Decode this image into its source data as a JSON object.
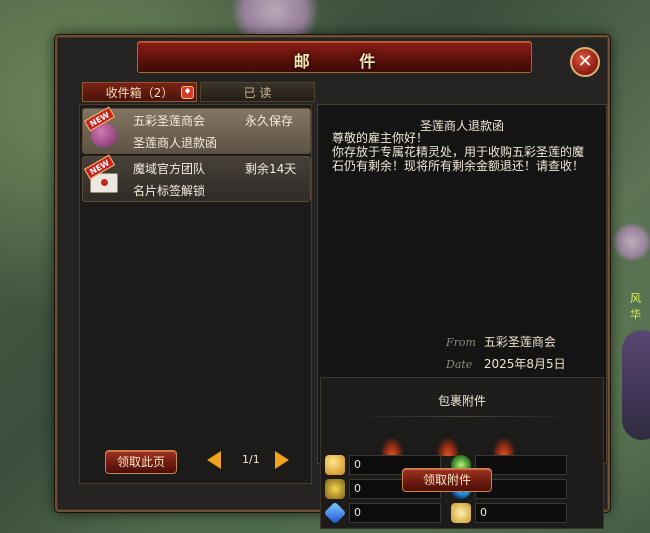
{
  "window": {
    "title": "邮 件",
    "close_icon": "close-icon"
  },
  "tabs": [
    {
      "label": "收件箱（2）",
      "active": true,
      "icon": "gift-icon"
    },
    {
      "label": "已 读",
      "active": false
    }
  ],
  "mail_list": [
    {
      "badge": "NEW",
      "icon": "pouch-icon",
      "sender": "五彩圣莲商会",
      "status": "永久保存",
      "subject": "圣莲商人退款函",
      "selected": true
    },
    {
      "badge": "NEW",
      "icon": "envelope-icon",
      "sender": "魔域官方团队",
      "status": "剩余14天",
      "subject": "名片标签解锁",
      "selected": false
    }
  ],
  "pager": {
    "text": "1/1"
  },
  "buttons": {
    "claim_page": "领取此页",
    "claim_attachment": "领取附件"
  },
  "mail_view": {
    "subject": "圣莲商人退款函",
    "body": "尊敬的雇主你好！\n你存放于专属花精灵处，用于收购五彩圣莲的魔石仍有剩余！现将所有剩余金额退还！请查收！",
    "from_label": "From",
    "from_value": "五彩圣莲商会",
    "date_label": "Date",
    "date_value": "2025年8月5日"
  },
  "attachments": {
    "title": "包裹附件",
    "resources": [
      {
        "icon": "gold-icon",
        "value": "0"
      },
      {
        "icon": "green-orb-icon",
        "value": ""
      },
      {
        "icon": "gold-flower-icon",
        "value": "0"
      },
      {
        "icon": "blue-moon-icon",
        "value": "0"
      },
      {
        "icon": "blue-crystal-icon",
        "value": "0"
      },
      {
        "icon": "golden-wing-icon",
        "value": "0"
      }
    ]
  },
  "background": {
    "side_text": "风华"
  }
}
